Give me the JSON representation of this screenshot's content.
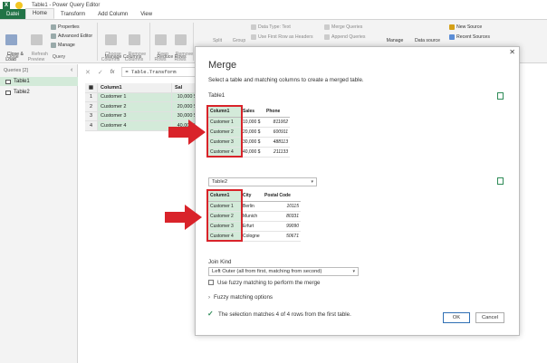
{
  "window": {
    "title": "Table1 - Power Query Editor"
  },
  "ribbon_tabs": [
    "Datei",
    "Home",
    "Transform",
    "Add Column",
    "View"
  ],
  "ribbon": {
    "close_load": "Close &\nLoad",
    "refresh_preview": "Refresh\nPreview",
    "properties": "Properties",
    "advanced_editor": "Advanced Editor",
    "manage": "Manage",
    "choose_columns": "Choose\nColumns",
    "remove_columns": "Remove\nColumns",
    "keep_rows": "Keep\nRows",
    "remove_rows": "Remove\nRows",
    "split": "Split",
    "group": "Group",
    "data_type": "Data Type: Text",
    "first_row_headers": "Use First Row as Headers",
    "merge_queries": "Merge Queries",
    "append_queries": "Append Queries",
    "manage2": "Manage",
    "data_source": "Data source",
    "new_source": "New Source",
    "recent_sources": "Recent Sources",
    "groups": {
      "close": "Close",
      "query": "Query",
      "manage_columns": "Manage Columns",
      "reduce_rows": "Reduce Rows"
    }
  },
  "queries_pane": {
    "header": "Queries [2]",
    "items": [
      "Table1",
      "Table2"
    ]
  },
  "formula": {
    "fx": "fx",
    "text": "= Table.Transform"
  },
  "grid": {
    "header_col": "Column1",
    "header_col2": "Sal",
    "rows": [
      {
        "n": "1",
        "c1": "Customer 1",
        "c2": "10,000 $"
      },
      {
        "n": "2",
        "c1": "Customer 2",
        "c2": "20,000 $"
      },
      {
        "n": "3",
        "c1": "Customer 3",
        "c2": "30,000 $"
      },
      {
        "n": "4",
        "c1": "Customer 4",
        "c2": "40,000 $"
      }
    ]
  },
  "dialog": {
    "title": "Merge",
    "subtitle": "Select a table and matching columns to create a merged table.",
    "table1_label": "Table1",
    "table1": {
      "headers": [
        "Column1",
        "Sales",
        "Phone"
      ],
      "rows": [
        [
          "Customer 1",
          "10,000 $",
          "811002"
        ],
        [
          "Customer 2",
          "20,000 $",
          "600911"
        ],
        [
          "Customer 3",
          "30,000 $",
          "488113"
        ],
        [
          "Customer 4",
          "40,000 $",
          "211133"
        ]
      ]
    },
    "table2_select": "Table2",
    "table2": {
      "headers": [
        "Column1",
        "City",
        "Postal Code"
      ],
      "rows": [
        [
          "Customer 1",
          "Berlin",
          "10115"
        ],
        [
          "Customer 2",
          "Munich",
          "80331"
        ],
        [
          "Customer 3",
          "Erfurt",
          "99090"
        ],
        [
          "Customer 4",
          "Cologne",
          "50671"
        ]
      ]
    },
    "join_kind_label": "Join Kind",
    "join_kind_value": "Left Outer (all from first, matching from second)",
    "fuzzy_checkbox": "Use fuzzy matching to perform the merge",
    "fuzzy_options": "Fuzzy matching options",
    "status": "The selection matches 4 of 4 rows from the first table.",
    "ok": "OK",
    "cancel": "Cancel"
  },
  "colors": {
    "accent_green": "#217346",
    "selection": "#d3ead9",
    "highlight_red": "#d9232a"
  }
}
